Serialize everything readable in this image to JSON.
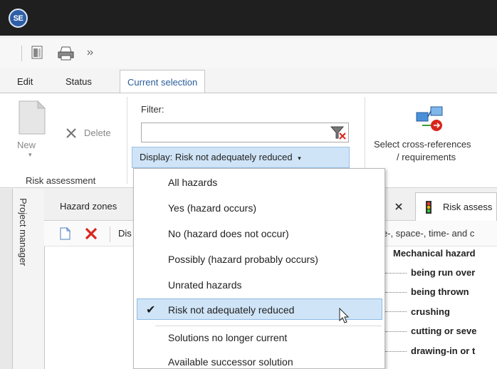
{
  "app": {
    "logo_text": "SE"
  },
  "quick_access": {
    "icons": [
      "window-icon",
      "printer-icon",
      "more-icon"
    ]
  },
  "tabs": [
    {
      "label": "Edit"
    },
    {
      "label": "Status"
    },
    {
      "label": "Current selection",
      "active": true
    }
  ],
  "ribbon": {
    "new_label": "New",
    "delete_label": "Delete",
    "group_risk_assessment": "Risk assessment",
    "filter_label": "Filter:",
    "filter_value": "",
    "display_button": "Display: Risk not adequately reduced",
    "cross_ref_line1": "Select cross-references",
    "cross_ref_line2": "/ requirements"
  },
  "side": {
    "project_manager": "Project manager"
  },
  "panel": {
    "hazard_zones_tab": "Hazard zones",
    "toolbar_text": "Dis",
    "risk_tab": "Risk assess",
    "header_text": "e-, space-, time- and c",
    "tree": [
      "Mechanical hazard",
      "being run over",
      "being thrown",
      "crushing",
      "cutting or seve",
      "drawing-in or t"
    ]
  },
  "dropdown": {
    "items": [
      {
        "label": "All hazards"
      },
      {
        "label": "Yes (hazard occurs)"
      },
      {
        "label": "No (hazard does not occur)"
      },
      {
        "label": "Possibly (hazard probably occurs)"
      },
      {
        "label": "Unrated hazards"
      },
      {
        "label": "Risk not adequately reduced",
        "selected": true
      },
      {
        "label": "Solutions no longer current"
      },
      {
        "label": "Available successor solution"
      }
    ]
  },
  "colors": {
    "titlebar": "#1f1f1f",
    "accent_blue": "#2a5c9a",
    "selection_bg": "#cfe4f7",
    "delete_red": "#d9261c"
  }
}
